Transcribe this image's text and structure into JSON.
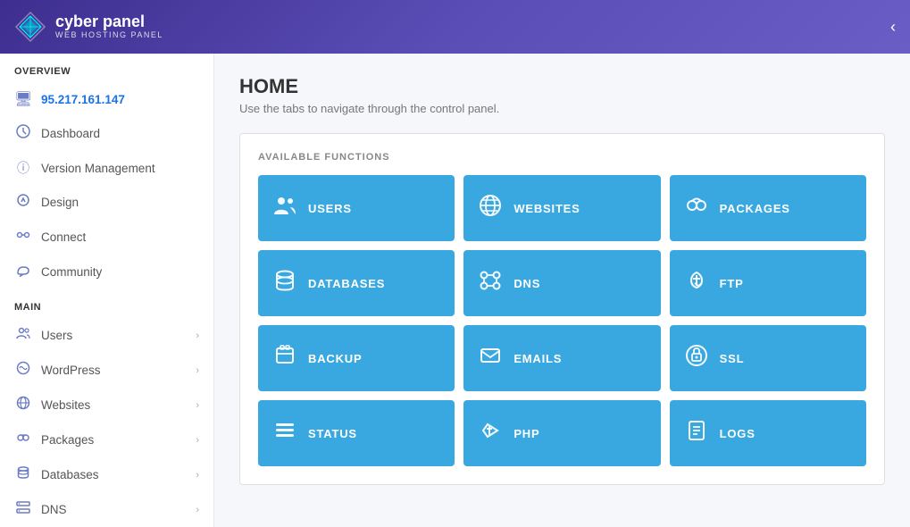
{
  "header": {
    "brand": "cyber panel",
    "sub": "WEB HOSTING PANEL",
    "toggle_icon": "☰"
  },
  "sidebar": {
    "overview_label": "OVERVIEW",
    "server_ip": "95.217.161.147",
    "overview_items": [
      {
        "id": "dashboard",
        "label": "Dashboard",
        "icon": "🎨"
      },
      {
        "id": "version-management",
        "label": "Version Management",
        "icon": "ℹ"
      },
      {
        "id": "design",
        "label": "Design",
        "icon": "⚙"
      },
      {
        "id": "connect",
        "label": "Connect",
        "icon": "🔗"
      },
      {
        "id": "community",
        "label": "Community",
        "icon": "💬"
      }
    ],
    "main_label": "MAIN",
    "main_items": [
      {
        "id": "users",
        "label": "Users",
        "icon": "👥",
        "has_arrow": true
      },
      {
        "id": "wordpress",
        "label": "WordPress",
        "icon": "🌀",
        "has_arrow": true
      },
      {
        "id": "websites",
        "label": "Websites",
        "icon": "🌐",
        "has_arrow": true
      },
      {
        "id": "packages",
        "label": "Packages",
        "icon": "🔄",
        "has_arrow": true
      },
      {
        "id": "databases",
        "label": "Databases",
        "icon": "🗄",
        "has_arrow": true
      },
      {
        "id": "dns",
        "label": "DNS",
        "icon": "📄",
        "has_arrow": true
      }
    ]
  },
  "main": {
    "title": "HOME",
    "subtitle": "Use the tabs to navigate through the control panel.",
    "functions_label": "AVAILABLE FUNCTIONS",
    "functions": [
      {
        "id": "users",
        "label": "USERS",
        "icon": "👥"
      },
      {
        "id": "websites",
        "label": "WEBSITES",
        "icon": "🌐"
      },
      {
        "id": "packages",
        "label": "PACKAGES",
        "icon": "📦"
      },
      {
        "id": "databases",
        "label": "DATABASES",
        "icon": "🗄"
      },
      {
        "id": "dns",
        "label": "DNS",
        "icon": "🔀"
      },
      {
        "id": "ftp",
        "label": "FTP",
        "icon": "☁"
      },
      {
        "id": "backup",
        "label": "BACKUP",
        "icon": "📋"
      },
      {
        "id": "emails",
        "label": "EMAILS",
        "icon": "✉"
      },
      {
        "id": "ssl",
        "label": "SSL",
        "icon": "🔒"
      },
      {
        "id": "status",
        "label": "STATUS",
        "icon": "≡"
      },
      {
        "id": "php",
        "label": "PHP",
        "icon": "⟨/⟩"
      },
      {
        "id": "logs",
        "label": "LOGS",
        "icon": "📄"
      }
    ]
  }
}
